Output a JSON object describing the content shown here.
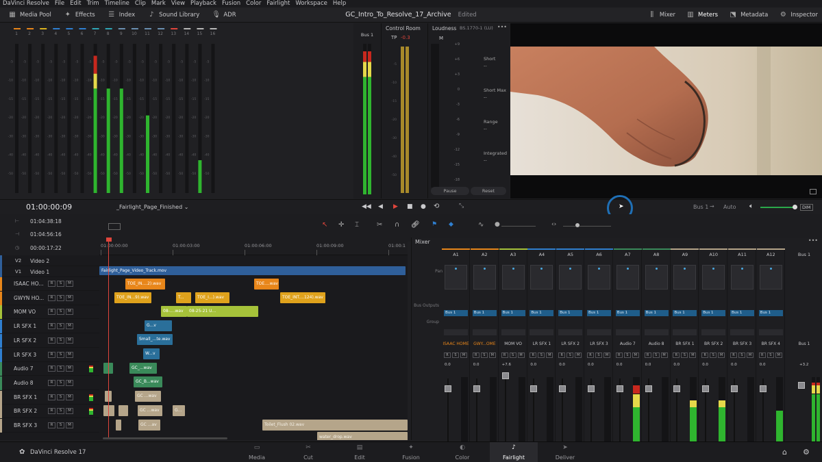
{
  "menu": [
    "DaVinci Resolve",
    "File",
    "Edit",
    "Trim",
    "Timeline",
    "Clip",
    "Mark",
    "View",
    "Playback",
    "Fusion",
    "Color",
    "Fairlight",
    "Workspace",
    "Help"
  ],
  "toolbar": {
    "media_pool": "Media Pool",
    "effects": "Effects",
    "index": "Index",
    "sound_library": "Sound Library",
    "adr": "ADR",
    "mixer": "Mixer",
    "meters": "Meters",
    "metadata": "Metadata",
    "inspector": "Inspector"
  },
  "project": {
    "title": "GC_Intro_To_Resolve_17_Archive",
    "status": "Edited"
  },
  "meters": {
    "channel_numbers": [
      "1",
      "2",
      "3",
      "4",
      "5",
      "6",
      "7",
      "8",
      "9",
      "10",
      "11",
      "12",
      "13",
      "14",
      "15",
      "16"
    ],
    "scale": [
      "-5",
      "-10",
      "-15",
      "-20",
      "-30",
      "-40",
      "-50"
    ],
    "levels": [
      0,
      0,
      0,
      0,
      0,
      0,
      0.92,
      0.7,
      0.7,
      0,
      0.52,
      0,
      0,
      0,
      0.22,
      0
    ],
    "bus_label": "Bus 1",
    "bus_levels": [
      0.95,
      0.95
    ]
  },
  "control_room": {
    "title": "Control Room",
    "tp_label": "TP",
    "tp_value": "-0.3",
    "levels": [
      1.0,
      1.0
    ]
  },
  "loudness": {
    "title": "Loudness",
    "standard": "BS.1770-1 (LU)",
    "m_label": "M",
    "short_label": "Short",
    "short_value": "--",
    "short_max_label": "Short Max",
    "short_max_value": "--",
    "range_label": "Range",
    "range_value": "--",
    "integrated_label": "Integrated",
    "integrated_value": "--",
    "scale": [
      "+9",
      "+6",
      "+3",
      "0",
      "-3",
      "-6",
      "-9",
      "-12",
      "-15",
      "-18"
    ],
    "pause": "Pause",
    "reset": "Reset"
  },
  "transport": {
    "timecode": "01:00:00:09",
    "timeline_name": "_Fairlight_Page_Finished",
    "bus": "Bus 1",
    "auto": "Auto",
    "dim": "DIM"
  },
  "timeline": {
    "tc1": "01:04:38:18",
    "tc2": "01:04:56:16",
    "tc3": "00:00:17:22",
    "ruler": [
      "01:00:00:00",
      "01:00:03:00",
      "01:00:06:00",
      "01:00:09:00",
      "01:00:1"
    ],
    "video_tracks": [
      {
        "id": "V2",
        "name": "Video 2"
      },
      {
        "id": "V1",
        "name": "Video 1"
      }
    ],
    "audio_tracks": [
      "ISAAC HO...",
      "GWYN HO...",
      "MOM VO",
      "LR SFX 1",
      "LR SFX 2",
      "LR SFX 3",
      "Audio 7",
      "Audio 8",
      "BR SFX 1",
      "BR SFX 2",
      "BR SFX 3"
    ],
    "video_clip": "Fairlight_Page_Video_Track.mov",
    "clips": {
      "c1": "TOE_IN....2).wav",
      "c2": "TOE....wav",
      "c3": "TOE_IN...9).wav",
      "c4": "T...",
      "c5": "TOE_I...).wav",
      "c6": "TOE_INT....124).wav",
      "c7": "08-....wav",
      "c8": "08-25-21 U...",
      "c9": "G...v",
      "c10": "Small_...te.wav",
      "c11": "W...v",
      "c12": "GC_...wav",
      "c13": "GC_B...wav",
      "c14": "GC ...wav",
      "c15": "GC ...wav",
      "c16": "G...",
      "c17": "GC ...av",
      "c18": "Toilet_Flush 02.wav",
      "c19": "water_drop.wav"
    }
  },
  "mixer": {
    "title": "Mixer",
    "channels": [
      "A1",
      "A2",
      "A3",
      "A4",
      "A5",
      "A6",
      "A7",
      "A8",
      "A9",
      "A10",
      "A11",
      "A12"
    ],
    "bus": "Bus 1",
    "pan_label": "Pan",
    "bus_outputs_label": "Bus Outputs",
    "group_label": "Group",
    "output": "Bus 1",
    "track_names": [
      "ISAAC HOME",
      "GWY...OME",
      "MOM VO",
      "LR SFX 1",
      "LR SFX 2",
      "LR SFX 3",
      "Audio 7",
      "Audio 8",
      "BR SFX 1",
      "BR SFX 2",
      "BR SFX 3",
      "BR SFX 4"
    ],
    "gains": [
      "0.0",
      "0.0",
      "+7.6",
      "0.0",
      "0.0",
      "0.0",
      "0.0",
      "0.0",
      "0.0",
      "0.0",
      "0.0",
      "0.0"
    ],
    "bus_gain": "+3.2",
    "levels": [
      0,
      0,
      0,
      0,
      0,
      0,
      0.88,
      0,
      0.65,
      0.65,
      0,
      0.5
    ],
    "bus_levels": [
      0.92,
      0.92
    ]
  },
  "pages": [
    "Media",
    "Cut",
    "Edit",
    "Fusion",
    "Color",
    "Fairlight",
    "Deliver"
  ],
  "active_page": "Fairlight",
  "app_name": "DaVinci Resolve 17"
}
